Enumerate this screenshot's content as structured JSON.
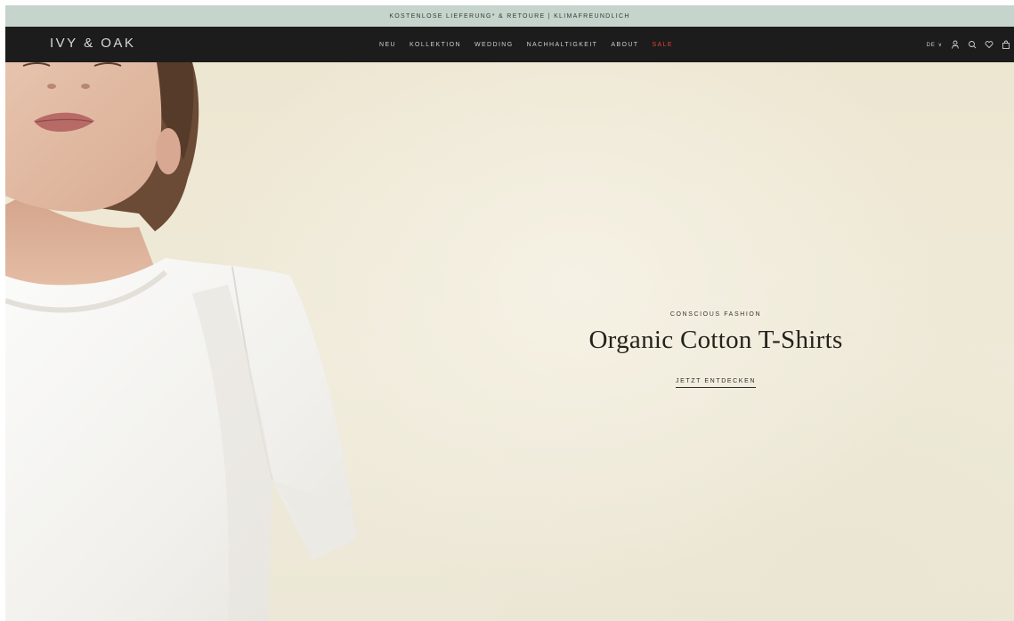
{
  "announcement": {
    "text": "KOSTENLOSE LIEFERUNG* & RETOURE | KLIMAFREUNDLICH"
  },
  "header": {
    "logo": "IVY & OAK",
    "menu": [
      {
        "label": "NEU"
      },
      {
        "label": "KOLLEKTION"
      },
      {
        "label": "WEDDING"
      },
      {
        "label": "NACHHALTIGKEIT"
      },
      {
        "label": "ABOUT"
      },
      {
        "label": "SALE"
      }
    ],
    "language": "DE ∨",
    "icons": [
      "account-icon",
      "search-icon",
      "wishlist-heart-icon",
      "shopping-bag-icon"
    ]
  },
  "hero": {
    "eyebrow": "CONSCIOUS FASHION",
    "headline": "Organic Cotton T-Shirts",
    "cta": "JETZT ENTDECKEN"
  },
  "colors": {
    "announcement_bg": "#c5d4cc",
    "nav_bg": "#1c1c1c",
    "sale": "#e0452e",
    "hero_bg": "#f0ebdc"
  }
}
